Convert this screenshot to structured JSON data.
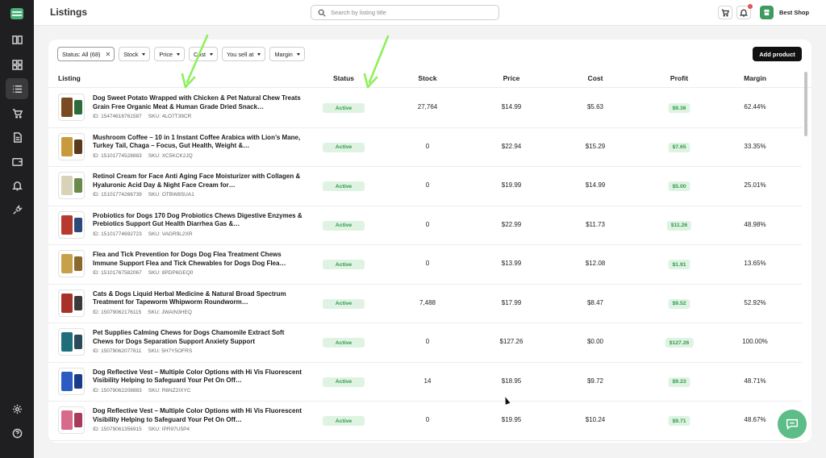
{
  "app": {
    "page_title": "Listings",
    "search_placeholder": "Search by listing title",
    "shop_name": "Best Shop"
  },
  "sidebar": {
    "icons": [
      "book-icon",
      "grid-icon",
      "list-icon",
      "cart-icon",
      "document-icon",
      "wallet-icon",
      "bell-icon",
      "plug-icon",
      "settings-icon",
      "help-icon"
    ]
  },
  "filters": {
    "status": "Status: All (68)",
    "stock": "Stock",
    "price": "Price",
    "cost": "Cost",
    "you_sell_at": "You sell at",
    "margin": "Margin",
    "clear_icon": "✕"
  },
  "add_product_label": "Add product",
  "table": {
    "headers": {
      "listing": "Listing",
      "status": "Status",
      "stock": "Stock",
      "price": "Price",
      "cost": "Cost",
      "profit": "Profit",
      "margin": "Margin"
    },
    "rows": [
      {
        "title": "Dog Sweet Potato Wrapped with Chicken & Pet Natural Chew Treats Grain Free Organic Meat & Human Grade Dried Snack…",
        "id": "ID: 15474618761587",
        "sku": "SKU: 4LO7T39CR",
        "status": "Active",
        "stock": "27,764",
        "price": "$14.99",
        "cost": "$5.63",
        "profit": "$9.36",
        "margin": "62.44%",
        "thumb_color": "#7a4a22",
        "thumb_color2": "#2e6b3a"
      },
      {
        "title": "Mushroom Coffee – 10 in 1 Instant Coffee Arabica with Lion’s Mane, Turkey Tail, Chaga – Focus, Gut Health, Weight &…",
        "id": "ID: 15101774528883",
        "sku": "SKU: XC5KCK2JQ",
        "status": "Active",
        "stock": "0",
        "price": "$22.94",
        "cost": "$15.29",
        "profit": "$7.65",
        "margin": "33.35%",
        "thumb_color": "#c99a3c",
        "thumb_color2": "#5a3a1c"
      },
      {
        "title": "Retinol Cream for Face Anti Aging Face Moisturizer with Collagen & Hyaluronic Acid Day & Night Face Cream for…",
        "id": "ID: 15101774266739",
        "sku": "SKU: OTBW8SUA1",
        "status": "Active",
        "stock": "0",
        "price": "$19.99",
        "cost": "$14.99",
        "profit": "$5.00",
        "margin": "25.01%",
        "thumb_color": "#d8d3b8",
        "thumb_color2": "#6a8a4a"
      },
      {
        "title": "Probiotics for Dogs 170 Dog Probiotics Chews Digestive Enzymes & Prebiotics Support Gut Health Diarrhea Gas &…",
        "id": "ID: 15101774692723",
        "sku": "SKU: VAGR9L2XR",
        "status": "Active",
        "stock": "0",
        "price": "$22.99",
        "cost": "$11.73",
        "profit": "$11.26",
        "margin": "48.98%",
        "thumb_color": "#b8392e",
        "thumb_color2": "#2b4a7a"
      },
      {
        "title": "Flea and Tick Prevention for Dogs Dog Flea Treatment Chews Immune Support Flea and Tick Chewables for Dogs Dog Flea…",
        "id": "ID: 15101767582067",
        "sku": "SKU: 8PDP6GEQ0",
        "status": "Active",
        "stock": "0",
        "price": "$13.99",
        "cost": "$12.08",
        "profit": "$1.91",
        "margin": "13.65%",
        "thumb_color": "#c9a04a",
        "thumb_color2": "#8a6a2a"
      },
      {
        "title": "Cats & Dogs Liquid Herbal Medicine & Natural Broad Spectrum Treatment for Tapeworm Whipworm Roundworm…",
        "id": "ID: 15079062176115",
        "sku": "SKU: JWAIN3HEQ",
        "status": "Active",
        "stock": "7,488",
        "price": "$17.99",
        "cost": "$8.47",
        "profit": "$9.52",
        "margin": "52.92%",
        "thumb_color": "#a8322a",
        "thumb_color2": "#3a3a3a"
      },
      {
        "title": "Pet Supplies Calming Chews for Dogs Chamomile Extract Soft Chews for Dogs Separation Support Anxiety Support",
        "id": "ID: 15079062077811",
        "sku": "SKU: 5H7Y5OFRS",
        "status": "Active",
        "stock": "0",
        "price": "$127.26",
        "cost": "$0.00",
        "profit": "$127.26",
        "margin": "100.00%",
        "thumb_color": "#1f6e7a",
        "thumb_color2": "#2a4a5a"
      },
      {
        "title": "Dog Reflective Vest – Multiple Color Options with Hi Vis Fluorescent Visibility Helping to Safeguard Your Pet On Off…",
        "id": "ID: 15079062208883",
        "sku": "SKU: R6NZ2IXYC",
        "status": "Active",
        "stock": "14",
        "price": "$18.95",
        "cost": "$9.72",
        "profit": "$9.23",
        "margin": "48.71%",
        "thumb_color": "#2d5bc4",
        "thumb_color2": "#1a3a8a"
      },
      {
        "title": "Dog Reflective Vest – Multiple Color Options with Hi Vis Fluorescent Visibility Helping to Safeguard Your Pet On Off…",
        "id": "ID: 15079061356915",
        "sku": "SKU: IPR97U5P4",
        "status": "Active",
        "stock": "0",
        "price": "$19.95",
        "cost": "$10.24",
        "profit": "$9.71",
        "margin": "48.67%",
        "thumb_color": "#d86a8a",
        "thumb_color2": "#a83a5a"
      }
    ]
  },
  "colors": {
    "accent_green": "#2e9a4c",
    "badge_bg": "#dff3e3",
    "annotation_arrow": "#8ef05a",
    "sidebar_bg": "#1f1f21"
  }
}
